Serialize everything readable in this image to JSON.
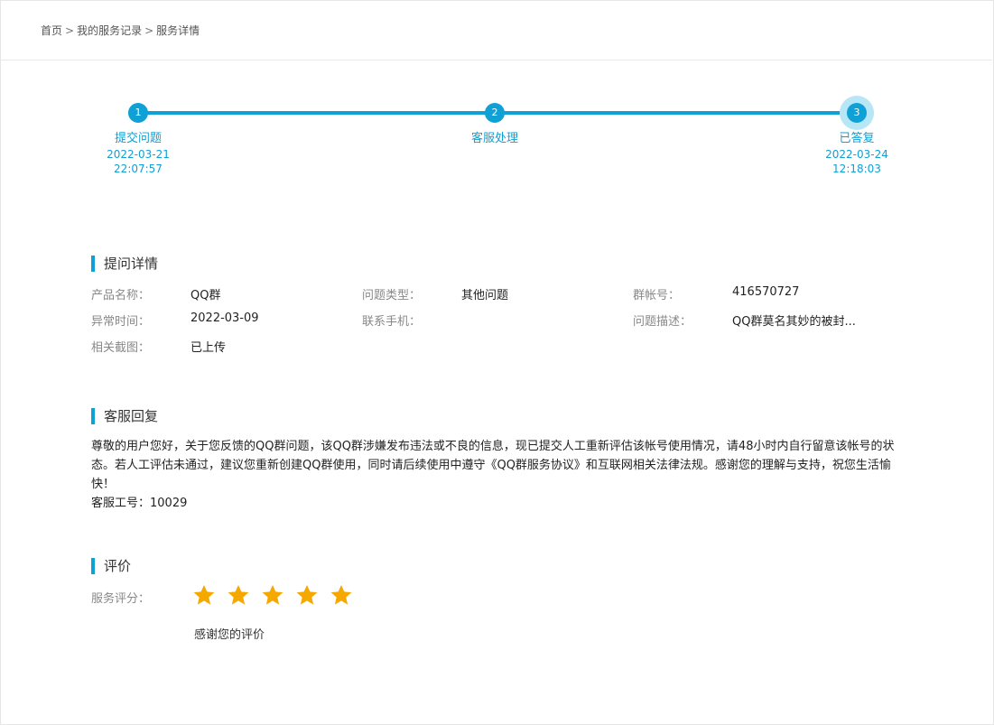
{
  "breadcrumb": {
    "home": "首页",
    "sep": ">",
    "records": "我的服务记录",
    "current": "服务详情"
  },
  "steps": [
    {
      "num": "1",
      "label": "提交问题",
      "date": "2022-03-21",
      "time": "22:07:57"
    },
    {
      "num": "2",
      "label": "客服处理",
      "date": "",
      "time": ""
    },
    {
      "num": "3",
      "label": "已答复",
      "date": "2022-03-24",
      "time": "12:18:03"
    }
  ],
  "details": {
    "title": "提问详情",
    "product_label": "产品名称：",
    "product_value": "QQ群",
    "type_label": "问题类型：",
    "type_value": "其他问题",
    "account_label": "群帐号：",
    "account_value": "416570727",
    "time_label": "异常时间：",
    "time_value": "2022-03-09",
    "phone_label": "联系手机：",
    "phone_value": "",
    "desc_label": "问题描述：",
    "desc_value": "QQ群莫名其妙的被封...",
    "screenshot_label": "相关截图：",
    "screenshot_value": "已上传"
  },
  "reply": {
    "title": "客服回复",
    "text": "尊敬的用户您好，关于您反馈的QQ群问题，该QQ群涉嫌发布违法或不良的信息，现已提交人工重新评估该帐号使用情况，请48小时内自行留意该帐号的状态。若人工评估未通过，建议您重新创建QQ群使用，同时请后续使用中遵守《QQ群服务协议》和互联网相关法律法规。感谢您的理解与支持，祝您生活愉快！",
    "agent": "客服工号：10029"
  },
  "rating": {
    "title": "评价",
    "label": "服务评分：",
    "stars": 5,
    "max_stars": 5,
    "thanks": "感谢您的评价"
  },
  "colors": {
    "accent": "#0fa0d6",
    "star": "#f5a800"
  }
}
